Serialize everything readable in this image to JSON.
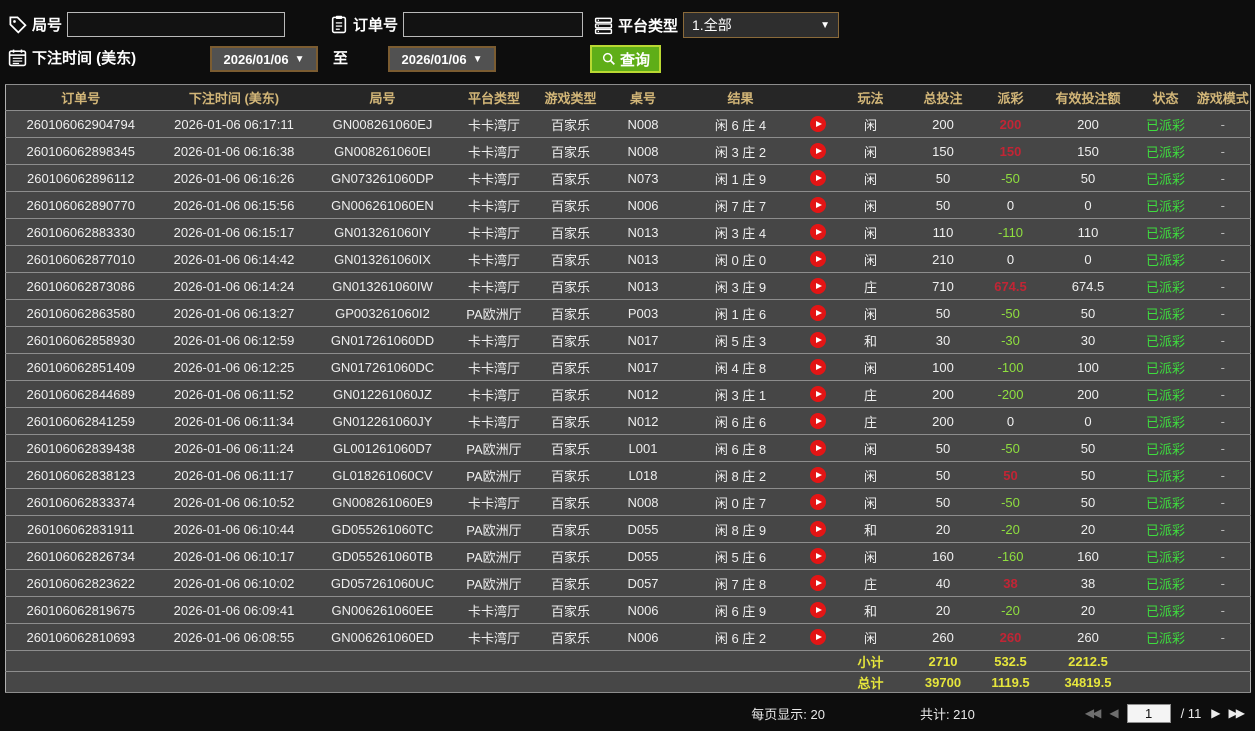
{
  "filters": {
    "round_no": {
      "label": "局号",
      "value": ""
    },
    "order_no": {
      "label": "订单号",
      "value": ""
    },
    "platform": {
      "label": "平台类型",
      "selected": "1.全部"
    },
    "bet_time": {
      "label": "下注时间 (美东)",
      "from": "2026/01/06",
      "to_label": "至",
      "to": "2026/01/06"
    },
    "query": {
      "label": "查询"
    }
  },
  "table": {
    "headers": [
      "订单号",
      "下注时间 (美东)",
      "局号",
      "平台类型",
      "游戏类型",
      "桌号",
      "结果",
      "",
      "玩法",
      "总投注",
      "派彩",
      "有效投注额",
      "状态",
      "游戏模式"
    ],
    "rows": [
      {
        "order_no": "260106062904794",
        "bet_time": "2026-01-06 06:17:11",
        "round_no": "GN008261060EJ",
        "platform": "卡卡湾厅",
        "game_type": "百家乐",
        "table_no": "N008",
        "result": "闲 6 庄 4",
        "play": "闲",
        "total_bet": "200",
        "payout": "200",
        "payout_tone": "pos",
        "valid_bet": "200",
        "status": "已派彩",
        "mode": "-"
      },
      {
        "order_no": "260106062898345",
        "bet_time": "2026-01-06 06:16:38",
        "round_no": "GN008261060EI",
        "platform": "卡卡湾厅",
        "game_type": "百家乐",
        "table_no": "N008",
        "result": "闲 3 庄 2",
        "play": "闲",
        "total_bet": "150",
        "payout": "150",
        "payout_tone": "pos",
        "valid_bet": "150",
        "status": "已派彩",
        "mode": "-"
      },
      {
        "order_no": "260106062896112",
        "bet_time": "2026-01-06 06:16:26",
        "round_no": "GN073261060DP",
        "platform": "卡卡湾厅",
        "game_type": "百家乐",
        "table_no": "N073",
        "result": "闲 1 庄 9",
        "play": "闲",
        "total_bet": "50",
        "payout": "-50",
        "payout_tone": "neg",
        "valid_bet": "50",
        "status": "已派彩",
        "mode": "-"
      },
      {
        "order_no": "260106062890770",
        "bet_time": "2026-01-06 06:15:56",
        "round_no": "GN006261060EN",
        "platform": "卡卡湾厅",
        "game_type": "百家乐",
        "table_no": "N006",
        "result": "闲 7 庄 7",
        "play": "闲",
        "total_bet": "50",
        "payout": "0",
        "payout_tone": "zero",
        "valid_bet": "0",
        "status": "已派彩",
        "mode": "-"
      },
      {
        "order_no": "260106062883330",
        "bet_time": "2026-01-06 06:15:17",
        "round_no": "GN013261060IY",
        "platform": "卡卡湾厅",
        "game_type": "百家乐",
        "table_no": "N013",
        "result": "闲 3 庄 4",
        "play": "闲",
        "total_bet": "110",
        "payout": "-110",
        "payout_tone": "neg",
        "valid_bet": "110",
        "status": "已派彩",
        "mode": "-"
      },
      {
        "order_no": "260106062877010",
        "bet_time": "2026-01-06 06:14:42",
        "round_no": "GN013261060IX",
        "platform": "卡卡湾厅",
        "game_type": "百家乐",
        "table_no": "N013",
        "result": "闲 0 庄 0",
        "play": "闲",
        "total_bet": "210",
        "payout": "0",
        "payout_tone": "zero",
        "valid_bet": "0",
        "status": "已派彩",
        "mode": "-"
      },
      {
        "order_no": "260106062873086",
        "bet_time": "2026-01-06 06:14:24",
        "round_no": "GN013261060IW",
        "platform": "卡卡湾厅",
        "game_type": "百家乐",
        "table_no": "N013",
        "result": "闲 3 庄 9",
        "play": "庄",
        "total_bet": "710",
        "payout": "674.5",
        "payout_tone": "pos",
        "valid_bet": "674.5",
        "status": "已派彩",
        "mode": "-"
      },
      {
        "order_no": "260106062863580",
        "bet_time": "2026-01-06 06:13:27",
        "round_no": "GP003261060I2",
        "platform": "PA欧洲厅",
        "game_type": "百家乐",
        "table_no": "P003",
        "result": "闲 1 庄 6",
        "play": "闲",
        "total_bet": "50",
        "payout": "-50",
        "payout_tone": "neg",
        "valid_bet": "50",
        "status": "已派彩",
        "mode": "-"
      },
      {
        "order_no": "260106062858930",
        "bet_time": "2026-01-06 06:12:59",
        "round_no": "GN017261060DD",
        "platform": "卡卡湾厅",
        "game_type": "百家乐",
        "table_no": "N017",
        "result": "闲 5 庄 3",
        "play": "和",
        "total_bet": "30",
        "payout": "-30",
        "payout_tone": "neg",
        "valid_bet": "30",
        "status": "已派彩",
        "mode": "-"
      },
      {
        "order_no": "260106062851409",
        "bet_time": "2026-01-06 06:12:25",
        "round_no": "GN017261060DC",
        "platform": "卡卡湾厅",
        "game_type": "百家乐",
        "table_no": "N017",
        "result": "闲 4 庄 8",
        "play": "闲",
        "total_bet": "100",
        "payout": "-100",
        "payout_tone": "neg",
        "valid_bet": "100",
        "status": "已派彩",
        "mode": "-"
      },
      {
        "order_no": "260106062844689",
        "bet_time": "2026-01-06 06:11:52",
        "round_no": "GN012261060JZ",
        "platform": "卡卡湾厅",
        "game_type": "百家乐",
        "table_no": "N012",
        "result": "闲 3 庄 1",
        "play": "庄",
        "total_bet": "200",
        "payout": "-200",
        "payout_tone": "neg",
        "valid_bet": "200",
        "status": "已派彩",
        "mode": "-"
      },
      {
        "order_no": "260106062841259",
        "bet_time": "2026-01-06 06:11:34",
        "round_no": "GN012261060JY",
        "platform": "卡卡湾厅",
        "game_type": "百家乐",
        "table_no": "N012",
        "result": "闲 6 庄 6",
        "play": "庄",
        "total_bet": "200",
        "payout": "0",
        "payout_tone": "zero",
        "valid_bet": "0",
        "status": "已派彩",
        "mode": "-"
      },
      {
        "order_no": "260106062839438",
        "bet_time": "2026-01-06 06:11:24",
        "round_no": "GL001261060D7",
        "platform": "PA欧洲厅",
        "game_type": "百家乐",
        "table_no": "L001",
        "result": "闲 6 庄 8",
        "play": "闲",
        "total_bet": "50",
        "payout": "-50",
        "payout_tone": "neg",
        "valid_bet": "50",
        "status": "已派彩",
        "mode": "-"
      },
      {
        "order_no": "260106062838123",
        "bet_time": "2026-01-06 06:11:17",
        "round_no": "GL018261060CV",
        "platform": "PA欧洲厅",
        "game_type": "百家乐",
        "table_no": "L018",
        "result": "闲 8 庄 2",
        "play": "闲",
        "total_bet": "50",
        "payout": "50",
        "payout_tone": "pos",
        "valid_bet": "50",
        "status": "已派彩",
        "mode": "-"
      },
      {
        "order_no": "260106062833374",
        "bet_time": "2026-01-06 06:10:52",
        "round_no": "GN008261060E9",
        "platform": "卡卡湾厅",
        "game_type": "百家乐",
        "table_no": "N008",
        "result": "闲 0 庄 7",
        "play": "闲",
        "total_bet": "50",
        "payout": "-50",
        "payout_tone": "neg",
        "valid_bet": "50",
        "status": "已派彩",
        "mode": "-"
      },
      {
        "order_no": "260106062831911",
        "bet_time": "2026-01-06 06:10:44",
        "round_no": "GD055261060TC",
        "platform": "PA欧洲厅",
        "game_type": "百家乐",
        "table_no": "D055",
        "result": "闲 8 庄 9",
        "play": "和",
        "total_bet": "20",
        "payout": "-20",
        "payout_tone": "neg",
        "valid_bet": "20",
        "status": "已派彩",
        "mode": "-"
      },
      {
        "order_no": "260106062826734",
        "bet_time": "2026-01-06 06:10:17",
        "round_no": "GD055261060TB",
        "platform": "PA欧洲厅",
        "game_type": "百家乐",
        "table_no": "D055",
        "result": "闲 5 庄 6",
        "play": "闲",
        "total_bet": "160",
        "payout": "-160",
        "payout_tone": "neg",
        "valid_bet": "160",
        "status": "已派彩",
        "mode": "-"
      },
      {
        "order_no": "260106062823622",
        "bet_time": "2026-01-06 06:10:02",
        "round_no": "GD057261060UC",
        "platform": "PA欧洲厅",
        "game_type": "百家乐",
        "table_no": "D057",
        "result": "闲 7 庄 8",
        "play": "庄",
        "total_bet": "40",
        "payout": "38",
        "payout_tone": "pos",
        "valid_bet": "38",
        "status": "已派彩",
        "mode": "-"
      },
      {
        "order_no": "260106062819675",
        "bet_time": "2026-01-06 06:09:41",
        "round_no": "GN006261060EE",
        "platform": "卡卡湾厅",
        "game_type": "百家乐",
        "table_no": "N006",
        "result": "闲 6 庄 9",
        "play": "和",
        "total_bet": "20",
        "payout": "-20",
        "payout_tone": "neg",
        "valid_bet": "20",
        "status": "已派彩",
        "mode": "-"
      },
      {
        "order_no": "260106062810693",
        "bet_time": "2026-01-06 06:08:55",
        "round_no": "GN006261060ED",
        "platform": "卡卡湾厅",
        "game_type": "百家乐",
        "table_no": "N006",
        "result": "闲 6 庄 2",
        "play": "闲",
        "total_bet": "260",
        "payout": "260",
        "payout_tone": "pos",
        "valid_bet": "260",
        "status": "已派彩",
        "mode": "-"
      }
    ],
    "subtotal": {
      "label": "小计",
      "total_bet": "2710",
      "payout": "532.5",
      "valid_bet": "2212.5"
    },
    "grand_total": {
      "label": "总计",
      "total_bet": "39700",
      "payout": "1119.5",
      "valid_bet": "34819.5"
    }
  },
  "footer": {
    "per_page": "每页显示: 20",
    "total_count": "共计: 210",
    "page_value": "1",
    "page_total": "/ 11",
    "first_arrow": "◀◀",
    "prev_arrow": "◀",
    "next_arrow": "▶",
    "last_arrow": "▶▶"
  },
  "colors": {
    "header_text": "#d2b678",
    "payout_positive": "#c22535",
    "payout_negative": "#8fdf3f",
    "status_green": "#3edc3e",
    "summary_yellow": "#e6e63c",
    "query_button_green": "#5fae18"
  }
}
